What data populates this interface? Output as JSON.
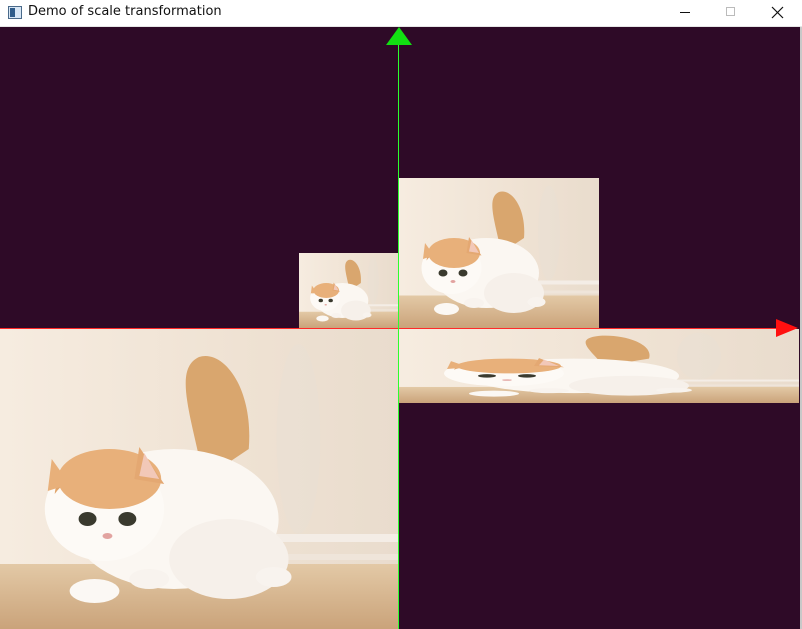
{
  "window": {
    "title": "Demo of scale transformation",
    "icons": {
      "app": "app-window-icon",
      "minimize": "minimize-icon",
      "maximize": "maximize-icon",
      "close": "close-icon"
    }
  },
  "canvas": {
    "background_color": "#2e0a27",
    "x_axis": {
      "color": "#ff0000",
      "icon": "arrow-right-icon"
    },
    "y_axis": {
      "color": "#00ff00",
      "icon": "arrow-up-icon"
    },
    "images": [
      {
        "name": "kitten-original",
        "description_icon": "kitten-photo",
        "scale_x": 1.0,
        "scale_y": 1.0
      },
      {
        "name": "kitten-half-scale",
        "description_icon": "kitten-photo",
        "scale_x": 0.5,
        "scale_y": 0.5
      },
      {
        "name": "kitten-negative-x-y-scale",
        "description_icon": "kitten-photo",
        "scale_x": -1.0,
        "scale_y": -1.0
      },
      {
        "name": "kitten-stretched-y",
        "description_icon": "kitten-photo",
        "scale_x": 1.0,
        "scale_y": -0.25
      }
    ]
  }
}
